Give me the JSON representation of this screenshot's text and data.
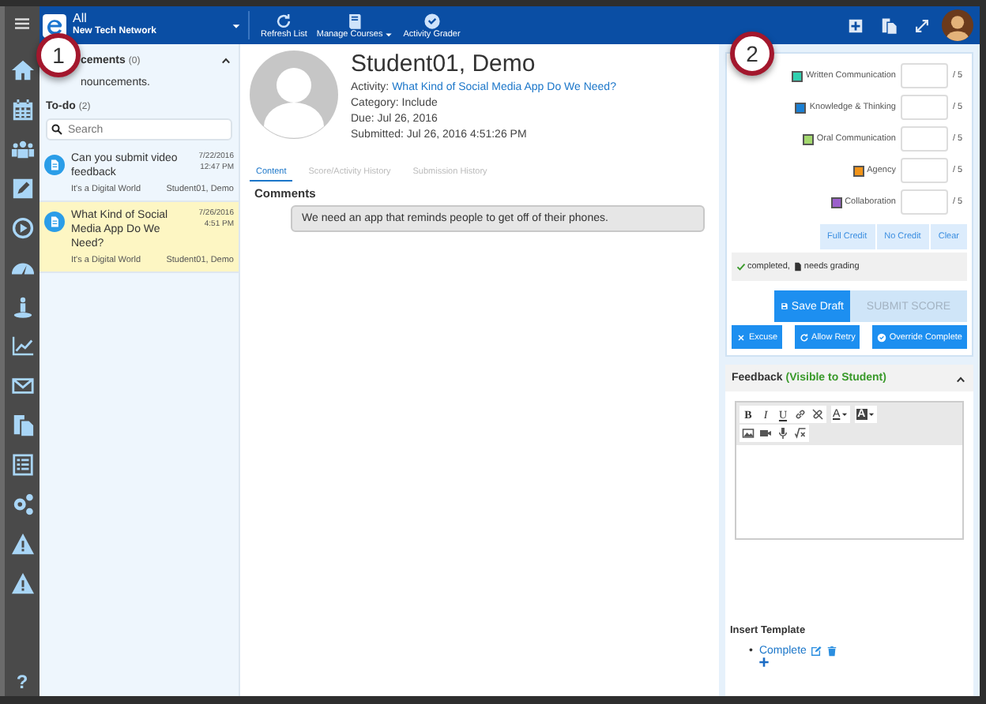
{
  "top_bar": {
    "org": "All",
    "network": "New Tech Network",
    "tools": [
      {
        "kind": "refresh",
        "label": "Refresh List",
        "dropdown": false
      },
      {
        "kind": "book",
        "label": "Manage Courses",
        "dropdown": true
      },
      {
        "kind": "check-circle",
        "label": "Activity Grader",
        "dropdown": false
      }
    ],
    "actions": [
      {
        "kind": "plus-square"
      },
      {
        "kind": "copy"
      },
      {
        "kind": "expand"
      }
    ]
  },
  "nav_rail": {
    "items": [
      {
        "kind": "home"
      },
      {
        "kind": "calendar"
      },
      {
        "kind": "people"
      },
      {
        "kind": "pencil"
      },
      {
        "kind": "play"
      },
      {
        "kind": "gauge"
      },
      {
        "kind": "person-pin"
      },
      {
        "kind": "chart"
      },
      {
        "kind": "mail"
      },
      {
        "kind": "copy"
      },
      {
        "kind": "list"
      },
      {
        "kind": "gears"
      },
      {
        "kind": "warning"
      },
      {
        "kind": "warning"
      }
    ],
    "help": "?"
  },
  "callouts": [
    "1",
    "2"
  ],
  "list_panel": {
    "announcements": {
      "title": "cements",
      "count": "(0)",
      "expanded": true,
      "message": "nouncements."
    },
    "todo": {
      "title": "To-do",
      "count": "(2)"
    },
    "search": {
      "placeholder": "Search"
    },
    "items": [
      {
        "title": "Can you submit video feedback",
        "date": "7/22/2016",
        "time": "12:47 PM",
        "course": "It's a Digital World",
        "student": "Student01, Demo",
        "selected": false
      },
      {
        "title": "What Kind of Social Media App Do We Need?",
        "date": "7/26/2016",
        "time": "4:51 PM",
        "course": "It's a Digital World",
        "student": "Student01, Demo",
        "selected": true
      }
    ]
  },
  "submission": {
    "student": "Student01, Demo",
    "activity_label": "Activity:",
    "activity": "What Kind of Social Media App Do We Need?",
    "category": "Category: Include",
    "due": "Due: Jul 26, 2016",
    "submitted": "Submitted: Jul 26, 2016 4:51:26 PM",
    "tabs": [
      {
        "label": "Content",
        "selected": true
      },
      {
        "label": "Score/Activity History",
        "selected": false
      },
      {
        "label": "Submission History",
        "selected": false
      }
    ],
    "comments_title": "Comments",
    "comment": "We need an app that reminds people to get off of their phones."
  },
  "grading": {
    "rubric": [
      {
        "label": "Written Communication",
        "color": "#2fd1b0",
        "max": "/ 5"
      },
      {
        "label": "Knowledge & Thinking",
        "color": "#1a7fd4",
        "max": "/ 5"
      },
      {
        "label": "Oral Communication",
        "color": "#a3d86e",
        "max": "/ 5"
      },
      {
        "label": "Agency",
        "color": "#f29418",
        "max": "/ 5"
      },
      {
        "label": "Collaboration",
        "color": "#9b5fcc",
        "max": "/ 5"
      }
    ],
    "quick": [
      "Full Credit",
      "No Credit",
      "Clear"
    ],
    "status": [
      {
        "kind": "check",
        "label": "completed,"
      },
      {
        "kind": "doc",
        "label": "needs grading"
      }
    ],
    "primary": [
      {
        "kind": "save",
        "label": "Save Draft",
        "disabled": false
      },
      {
        "kind": "submit",
        "label": "SUBMIT SCORE",
        "disabled": true
      }
    ],
    "secondary": [
      {
        "kind": "excuse",
        "label": "Excuse"
      },
      {
        "kind": "retry",
        "label": "Allow Retry"
      },
      {
        "kind": "override",
        "label": "Override Complete"
      }
    ],
    "feedback": {
      "title": "Feedback",
      "note": "(Visible to Student)",
      "expanded": true,
      "toolbar": [
        [
          [
            {
              "kind": "bold",
              "label": "B"
            },
            {
              "kind": "italic",
              "label": "I"
            },
            {
              "kind": "underline",
              "label": "U"
            },
            {
              "kind": "link"
            },
            {
              "kind": "unlink"
            }
          ],
          [
            {
              "kind": "text-color",
              "label": "A"
            }
          ],
          [
            {
              "kind": "highlight",
              "label": "A"
            }
          ]
        ],
        [
          [
            {
              "kind": "image"
            },
            {
              "kind": "video"
            },
            {
              "kind": "mic"
            },
            {
              "kind": "formula"
            }
          ]
        ]
      ]
    },
    "templates": {
      "title": "Insert Template",
      "bullet": "•",
      "items": [
        "Complete"
      ]
    }
  }
}
